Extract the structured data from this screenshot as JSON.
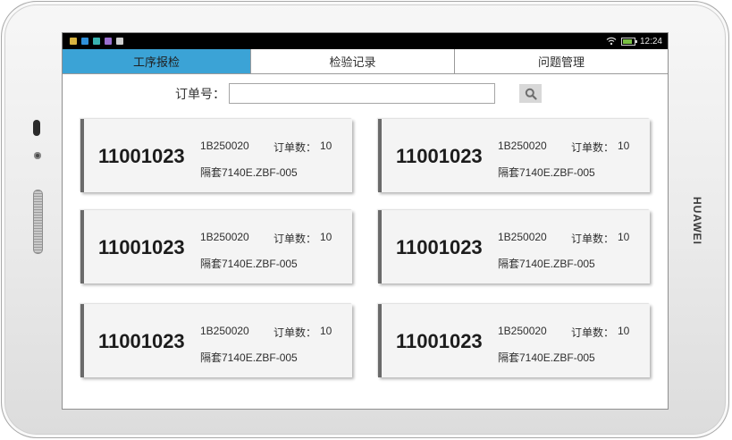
{
  "device": {
    "brand": "HUAWEI"
  },
  "statusbar": {
    "time": "12:24",
    "battery_level": 0.8,
    "notification_icons": [
      "app-icon",
      "app-icon",
      "app-icon",
      "app-icon",
      "app-icon"
    ]
  },
  "tabs": [
    {
      "label": "工序报检",
      "active": true
    },
    {
      "label": "检验记录",
      "active": false
    },
    {
      "label": "问题管理",
      "active": false
    }
  ],
  "search": {
    "label": "订单号：",
    "value": "",
    "placeholder": "",
    "button_icon": "search-icon"
  },
  "cards": [
    {
      "order": "11001023",
      "code": "1B250020",
      "qty_label": "订单数：",
      "qty": "10",
      "part": "隔套7140E.ZBF-005"
    },
    {
      "order": "11001023",
      "code": "1B250020",
      "qty_label": "订单数：",
      "qty": "10",
      "part": "隔套7140E.ZBF-005"
    },
    {
      "order": "11001023",
      "code": "1B250020",
      "qty_label": "订单数：",
      "qty": "10",
      "part": "隔套7140E.ZBF-005"
    },
    {
      "order": "11001023",
      "code": "1B250020",
      "qty_label": "订单数：",
      "qty": "10",
      "part": "隔套7140E.ZBF-005"
    },
    {
      "order": "11001023",
      "code": "1B250020",
      "qty_label": "订单数：",
      "qty": "10",
      "part": "隔套7140E.ZBF-005"
    },
    {
      "order": "11001023",
      "code": "1B250020",
      "qty_label": "订单数：",
      "qty": "10",
      "part": "隔套7140E.ZBF-005"
    }
  ],
  "colors": {
    "active_tab": "#3ba3d6",
    "card_background": "#f4f4f4",
    "card_accent": "#6a6a6a"
  }
}
